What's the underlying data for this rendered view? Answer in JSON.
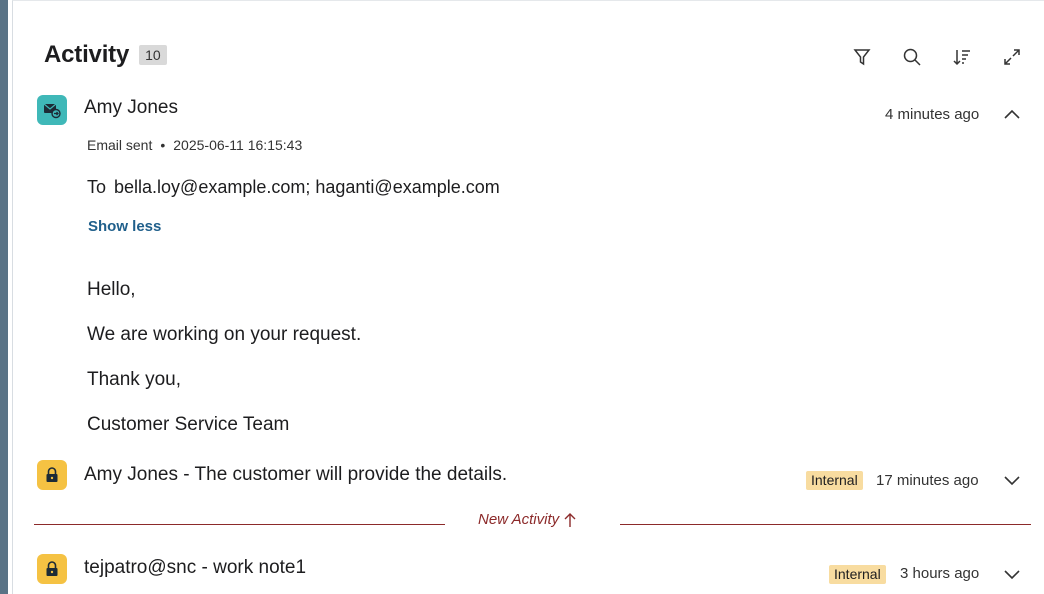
{
  "header": {
    "title": "Activity",
    "count": "10"
  },
  "toolbar": {
    "icons": [
      "filter-icon",
      "search-icon",
      "sort-icon",
      "expand-icon"
    ]
  },
  "entries": [
    {
      "icon": "email-icon",
      "author": "Amy Jones",
      "time": "4 minutes ago",
      "type": "Email sent",
      "timestamp": "2025-06-11 16:15:43",
      "to_label": "To",
      "to": "bella.loy@example.com; haganti@example.com",
      "toggle": "Show less",
      "body": [
        "Hello,",
        "We are working on your request.",
        "Thank you,",
        "Customer Service Team"
      ]
    },
    {
      "icon": "lock-icon",
      "author": "Amy Jones - The customer will provide the details.",
      "badge": "Internal",
      "time": "17 minutes ago"
    },
    {
      "icon": "lock-icon",
      "author": "tejpatro@snc - work note1",
      "badge": "Internal",
      "time": "3 hours ago"
    }
  ],
  "divider": {
    "label": "New Activity"
  },
  "colors": {
    "email_icon_bg": "#3fb8b8",
    "lock_icon_bg": "#f5c243",
    "badge_bg": "#f8dca0",
    "divider": "#8c2a2a",
    "link": "#1f5f8b"
  }
}
